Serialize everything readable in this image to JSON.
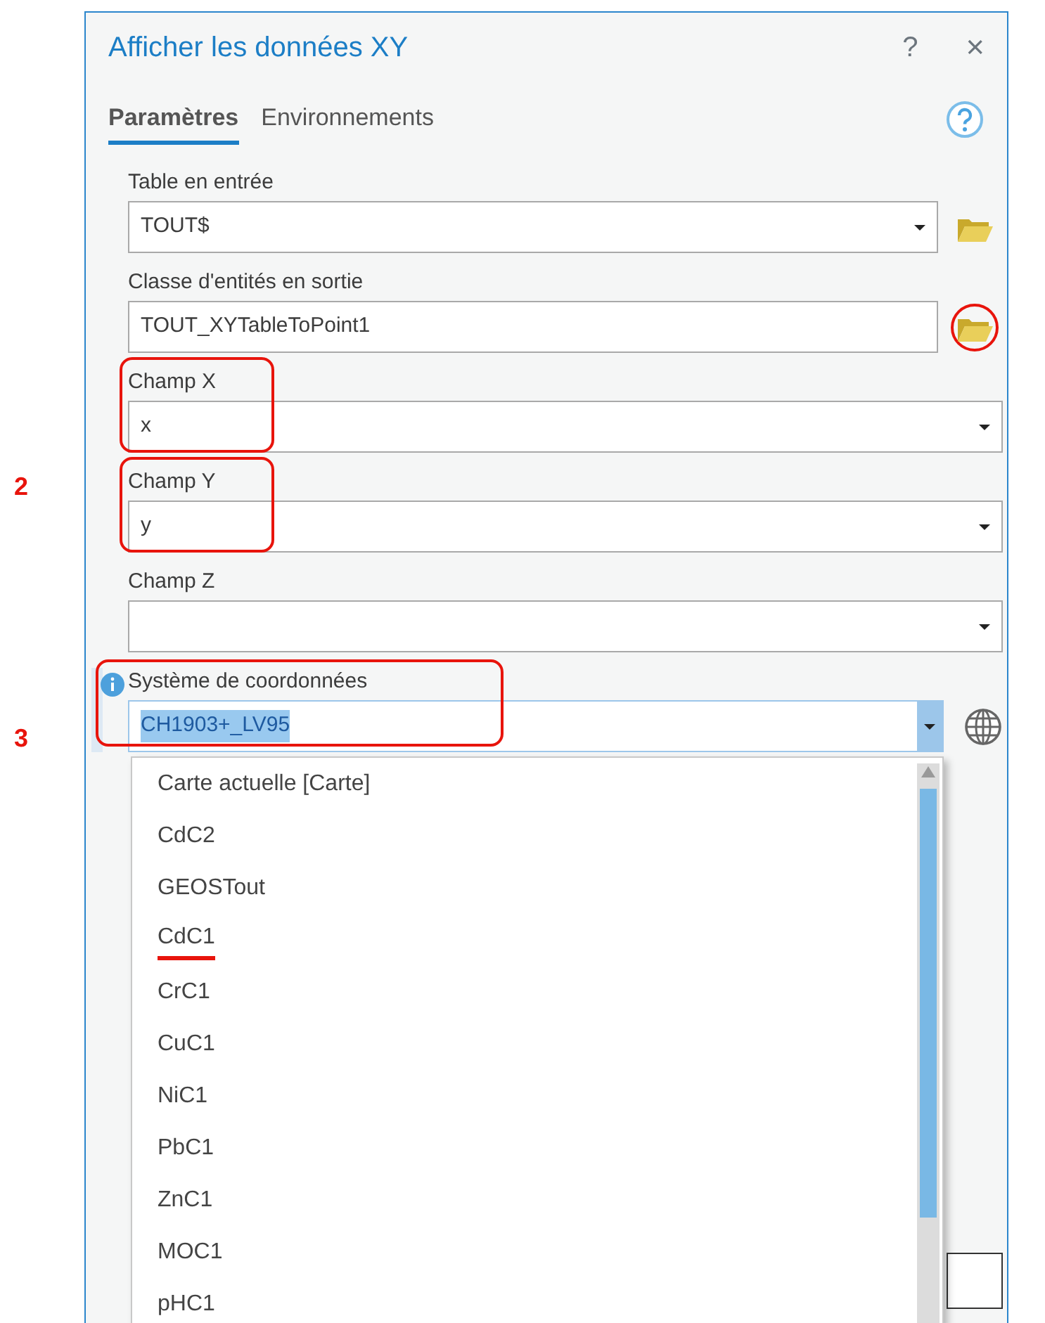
{
  "window": {
    "title": "Afficher les données XY",
    "help_glyph": "?",
    "close_glyph": "×"
  },
  "tabs": [
    {
      "label": "Paramètres",
      "selected": true
    },
    {
      "label": "Environnements",
      "selected": false
    }
  ],
  "fields": [
    {
      "label": "Table en entrée",
      "value": "TOUT$",
      "kind": "dropdown",
      "browse": true,
      "highlighted": false,
      "info": false
    },
    {
      "label": "Classe d'entités en sortie",
      "value": "TOUT_XYTableToPoint1",
      "kind": "text",
      "browse": true,
      "highlighted": false,
      "browse_highlighted": true,
      "info": false
    },
    {
      "label": "Champ X",
      "value": "x",
      "kind": "dropdown",
      "browse": false,
      "highlighted": true,
      "info": false
    },
    {
      "label": "Champ Y",
      "value": "y",
      "kind": "dropdown",
      "browse": false,
      "highlighted": true,
      "info": false
    },
    {
      "label": "Champ Z",
      "kind": "dropdown",
      "browse": false,
      "highlighted": false,
      "info": false
    },
    {
      "label": "Système de coordonnées",
      "value": "CH1903+_LV95",
      "kind": "coordinate",
      "browse": false,
      "highlighted": true,
      "info": true,
      "open": true
    }
  ],
  "dropdown_items": [
    {
      "label": "Carte actuelle [Carte]",
      "underlined": false
    },
    {
      "label": "CdC2",
      "underlined": false
    },
    {
      "label": "GEOSTout",
      "underlined": false
    },
    {
      "label": "CdC1",
      "underlined": true
    },
    {
      "label": "CrC1",
      "underlined": false
    },
    {
      "label": "CuC1",
      "underlined": false
    },
    {
      "label": "NiC1",
      "underlined": false
    },
    {
      "label": "PbC1",
      "underlined": false
    },
    {
      "label": "ZnC1",
      "underlined": false
    },
    {
      "label": "MOC1",
      "underlined": false
    },
    {
      "label": "pHC1",
      "underlined": false
    }
  ],
  "annotations": [
    {
      "label": "2"
    },
    {
      "label": "3"
    }
  ]
}
